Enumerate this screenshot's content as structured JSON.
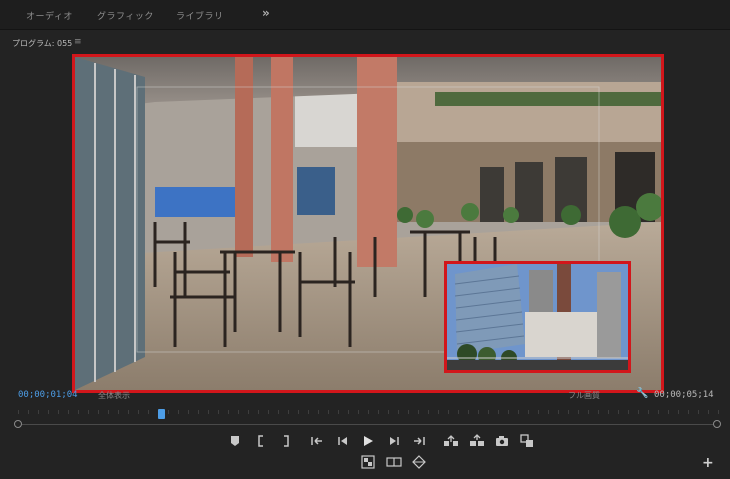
{
  "workspace_tabs": [
    "オーディオ",
    "グラフィック",
    "ライブラリ"
  ],
  "workspace_more": "»",
  "panel": {
    "title": "プログラム: 055",
    "menu": "≡"
  },
  "timecode": {
    "current": "00;00;01;04",
    "duration": "00;00;05;14"
  },
  "zoom_select": "全体表示",
  "quality_select": "フル画質",
  "playhead_fraction": 0.2,
  "transport": {
    "row1": [
      "marker-icon",
      "in-point-icon",
      "out-point-icon",
      "go-to-in-icon",
      "step-back-icon",
      "play-icon",
      "step-forward-icon",
      "go-to-out-icon",
      "lift-icon",
      "extract-icon",
      "export-frame-icon",
      "comparison-view-icon"
    ],
    "row2": [
      "vr-video-icon",
      "proxy-toggle-icon",
      "multi-camera-icon"
    ]
  },
  "add_label": "+",
  "colors": {
    "highlight": "#d2161b",
    "accent": "#4d9de6"
  }
}
